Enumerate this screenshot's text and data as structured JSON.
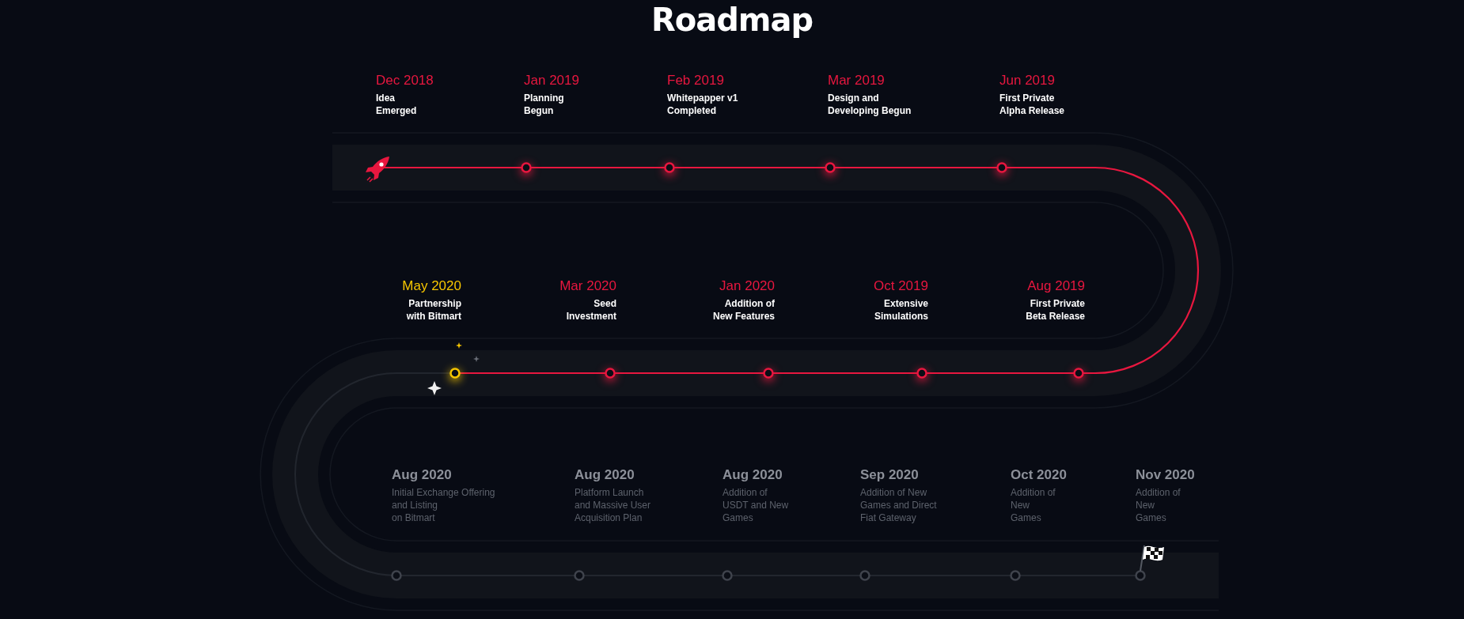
{
  "title": "Roadmap",
  "rows": [
    {
      "milestones": [
        {
          "date": "Dec 2018",
          "description": "Idea\nEmerged",
          "kind": "done"
        },
        {
          "date": "Jan 2019",
          "description": "Planning\nBegun",
          "kind": "done"
        },
        {
          "date": "Feb 2019",
          "description": "Whitepapper v1\nCompleted",
          "kind": "done"
        },
        {
          "date": "Mar 2019",
          "description": "Design and\nDeveloping Begun",
          "kind": "done"
        },
        {
          "date": "Jun 2019",
          "description": "First Private\nAlpha Release",
          "kind": "done"
        }
      ]
    },
    {
      "milestones": [
        {
          "date": "May 2020",
          "description": "Partnership\nwith Bitmart",
          "kind": "current"
        },
        {
          "date": "Mar 2020",
          "description": "Seed\nInvestment",
          "kind": "done"
        },
        {
          "date": "Jan 2020",
          "description": "Addition of\nNew Features",
          "kind": "done"
        },
        {
          "date": "Oct 2019",
          "description": "Extensive\nSimulations",
          "kind": "done"
        },
        {
          "date": "Aug 2019",
          "description": "First Private\nBeta Release",
          "kind": "done"
        }
      ]
    },
    {
      "milestones": [
        {
          "date": "Aug 2020",
          "description": "Initial Exchange Offering\nand Listing\non Bitmart",
          "kind": "upcoming"
        },
        {
          "date": "Aug 2020",
          "description": "Platform Launch\nand Massive User\nAcquisition Plan",
          "kind": "upcoming"
        },
        {
          "date": "Aug 2020",
          "description": "Addition of\nUSDT and New\nGames",
          "kind": "upcoming"
        },
        {
          "date": "Sep 2020",
          "description": "Addition of New\nGames and Direct\nFiat Gateway",
          "kind": "upcoming"
        },
        {
          "date": "Oct 2020",
          "description": "Addition of\nNew\nGames",
          "kind": "upcoming"
        },
        {
          "date": "Nov 2020",
          "description": "Addition of\nNew\nGames",
          "kind": "upcoming"
        }
      ]
    }
  ]
}
